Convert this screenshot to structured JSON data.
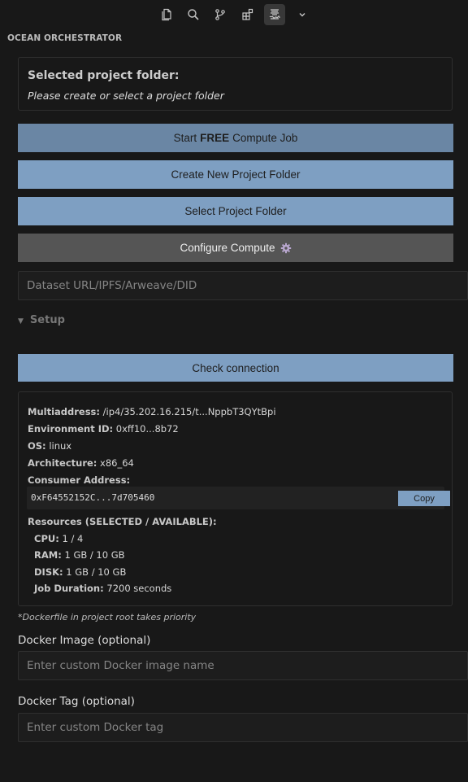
{
  "toolbar": {
    "icons": [
      "explorer-icon",
      "search-icon",
      "source-control-icon",
      "extensions-icon",
      "ocean-icon",
      "chevron-down-icon"
    ]
  },
  "section": {
    "title": "OCEAN ORCHESTRATOR"
  },
  "project": {
    "heading": "Selected project folder:",
    "status": "Please create or select a project folder"
  },
  "buttons": {
    "start_prefix": "Start",
    "start_bold": "FREE",
    "start_suffix": "Compute Job",
    "create_folder": "Create New Project Folder",
    "select_folder": "Select Project Folder",
    "configure": "Configure Compute",
    "check_connection": "Check connection",
    "copy": "Copy"
  },
  "dataset": {
    "placeholder": "Dataset URL/IPFS/Arweave/DID"
  },
  "setup": {
    "label": "Setup"
  },
  "environment": {
    "multiaddress_label": "Multiaddress:",
    "multiaddress_value": "/ip4/35.202.16.215/t...NppbT3QYtBpi",
    "env_id_label": "Environment ID:",
    "env_id_value": "0xff10...8b72",
    "os_label": "OS:",
    "os_value": "linux",
    "arch_label": "Architecture:",
    "arch_value": "x86_64",
    "consumer_label": "Consumer Address:",
    "consumer_value": "0xF64552152C...7d705460",
    "resources_label": "Resources (SELECTED / AVAILABLE):",
    "cpu_label": "CPU:",
    "cpu_value": "1 / 4",
    "ram_label": "RAM:",
    "ram_value": "1 GB / 10 GB",
    "disk_label": "DISK:",
    "disk_value": "1 GB / 10 GB",
    "duration_label": "Job Duration:",
    "duration_value": "7200 seconds"
  },
  "docker": {
    "note": "*Dockerfile in project root takes priority",
    "image_label": "Docker Image (optional)",
    "image_placeholder": "Enter custom Docker image name",
    "tag_label": "Docker Tag (optional)",
    "tag_placeholder": "Enter custom Docker tag"
  }
}
